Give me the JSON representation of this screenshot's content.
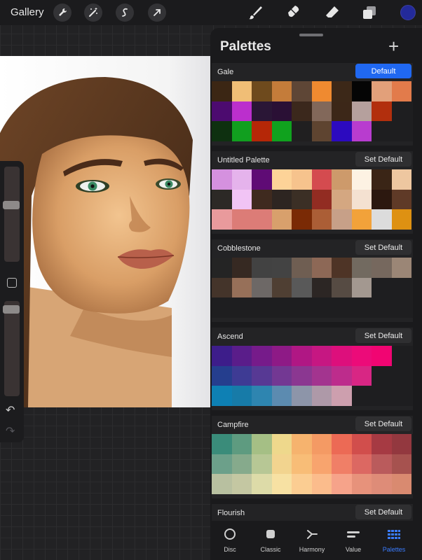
{
  "topbar": {
    "gallery_label": "Gallery",
    "tools_left": [
      "wrench-icon",
      "magic-wand-icon",
      "selection-icon",
      "transform-arrow-icon"
    ],
    "tools_right": [
      "brush-icon",
      "smudge-icon",
      "eraser-icon",
      "layers-icon"
    ],
    "current_color": "#232a9a"
  },
  "panel": {
    "title": "Palettes",
    "add_icon": "+",
    "palettes": [
      {
        "name": "Gale",
        "button": "Default",
        "is_default": true,
        "rows": [
          [
            "#3b2614",
            "#f0be76",
            "#6e4a1d",
            "#c47c3a",
            "#5e4636",
            "#ef8a30",
            "#3c2818",
            "#050505",
            "#e2a07a",
            "#e27b4b"
          ],
          [
            "#4c0b6f",
            "#bb2fcd",
            "#2a1636",
            "#2a1035",
            "#3b281c",
            "#82685a",
            "#3c2718",
            "#b5a09d",
            "#b22f0d",
            ""
          ],
          [
            "#0e3010",
            "#119f1f",
            "#b52707",
            "#10a21e",
            "#201f20",
            "#5e4430",
            "#2c0abf",
            "#b83ccf",
            "",
            ""
          ]
        ]
      },
      {
        "name": "Untitled Palette",
        "button": "Set Default",
        "is_default": false,
        "rows": [
          [
            "#d591df",
            "#e5b3ec",
            "#5f0b75",
            "#fdd398",
            "#f6c38d",
            "#d44b4f",
            "#cd9a6b",
            "#fdf2e3",
            "#3a2516",
            "#eec7a0"
          ],
          [
            "#2c2926",
            "#f1c4f5",
            "#3f2a1f",
            "#2d2521",
            "#3b2f25",
            "#922c22",
            "#d4a781",
            "#f4e1d1",
            "#2c180f",
            "#5f3a27"
          ],
          [
            "#e99a9c",
            "#dc7c77",
            "#dc7c77",
            "#d8a06c",
            "#7a2a05",
            "#ab5e36",
            "#c7a088",
            "#f2a23a",
            "#dcdcdc",
            "#de9112"
          ]
        ]
      },
      {
        "name": "Cobblestone",
        "button": "Set Default",
        "is_default": false,
        "rows": [
          [
            "#242424",
            "#362922",
            "#424242",
            "#434343",
            "#6f5e52",
            "#8d6856",
            "#4e3426",
            "#726a60",
            "#76685e",
            "#9b8676"
          ],
          [
            "#44342a",
            "#977059",
            "#6d6866",
            "#4f3f33",
            "#595959",
            "#2c2624",
            "#564b43",
            "#a39890",
            "",
            ""
          ],
          [
            "",
            "",
            "",
            "",
            "",
            "",
            "",
            "",
            "",
            ""
          ]
        ]
      },
      {
        "name": "Ascend",
        "button": "Set Default",
        "is_default": false,
        "rows": [
          [
            "#3d1d8a",
            "#5a1d8a",
            "#761b8a",
            "#8e1a86",
            "#b01784",
            "#c61782",
            "#dd0f7c",
            "#ec0b79",
            "#f10572",
            ""
          ],
          [
            "#253e8e",
            "#3e3b94",
            "#573994",
            "#733893",
            "#8b3791",
            "#a3348f",
            "#bd2c8c",
            "#d82684",
            "",
            ""
          ],
          [
            "#0e80b4",
            "#177ba8",
            "#2e85b0",
            "#5c8bb0",
            "#8d95a9",
            "#ae99a8",
            "#cd9fae",
            "",
            "",
            ""
          ]
        ]
      },
      {
        "name": "Campfire",
        "button": "Set Default",
        "is_default": false,
        "rows": [
          [
            "#3a8c7a",
            "#5e9b80",
            "#a5bf85",
            "#eed88c",
            "#f6b36e",
            "#f49a64",
            "#ec6a55",
            "#d14e4c",
            "#a63a43",
            "#93383f"
          ],
          [
            "#6ca08a",
            "#86aa8c",
            "#b7c795",
            "#f2d48f",
            "#f8bd77",
            "#f8a46e",
            "#f07f67",
            "#dc6862",
            "#ba5b5c",
            "#a6524f"
          ],
          [
            "#b8c0a0",
            "#c4c7a2",
            "#dddba8",
            "#f7e1a3",
            "#fbcd92",
            "#fbbc8c",
            "#f6a38a",
            "#e7927b",
            "#de8c78",
            "#d98a70"
          ]
        ]
      },
      {
        "name": "Flourish",
        "button": "Set Default",
        "is_default": false,
        "rows": []
      }
    ]
  },
  "tabs": [
    {
      "label": "Disc",
      "icon": "disc-icon",
      "active": false
    },
    {
      "label": "Classic",
      "icon": "classic-square-icon",
      "active": false
    },
    {
      "label": "Harmony",
      "icon": "harmony-icon",
      "active": false
    },
    {
      "label": "Value",
      "icon": "value-sliders-icon",
      "active": false
    },
    {
      "label": "Palettes",
      "icon": "palettes-grid-icon",
      "active": true
    }
  ],
  "sidebar": {
    "brush_size_level": 0.2,
    "opacity_level": 0.05
  }
}
